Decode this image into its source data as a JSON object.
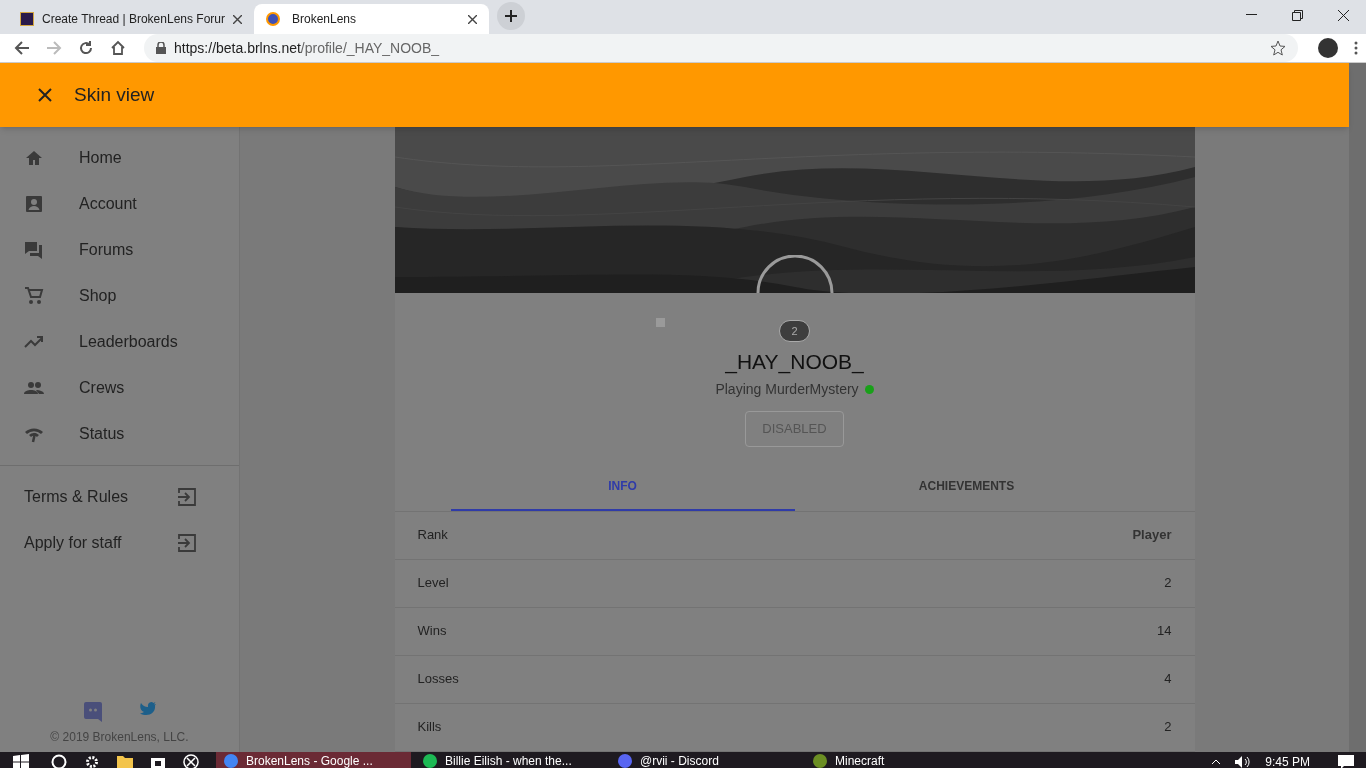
{
  "browser": {
    "tabs": [
      {
        "title": "Create Thread | BrokenLens Forur",
        "selected": false
      },
      {
        "title": "BrokenLens",
        "selected": true
      }
    ],
    "url_host": "https://beta.brlns.net",
    "url_path": "/profile/_HAY_NOOB_"
  },
  "header": {
    "title": "Skin view"
  },
  "sidebar": {
    "items": [
      "Home",
      "Account",
      "Forums",
      "Shop",
      "Leaderboards",
      "Crews",
      "Status"
    ],
    "links": [
      "Terms & Rules",
      "Apply for staff"
    ],
    "copyright": "© 2019 BrokenLens, LLC."
  },
  "profile": {
    "level": "2",
    "name": "_HAY_NOOB_",
    "status": "Playing MurderMystery",
    "online": true,
    "button": "DISABLED",
    "tabs": [
      {
        "label": "INFO",
        "selected": true
      },
      {
        "label": "ACHIEVEMENTS",
        "selected": false
      }
    ],
    "rows": [
      {
        "label": "Rank",
        "value": "Player"
      },
      {
        "label": "Level",
        "value": "2"
      },
      {
        "label": "Wins",
        "value": "14"
      },
      {
        "label": "Losses",
        "value": "4"
      },
      {
        "label": "Kills",
        "value": "2"
      }
    ]
  },
  "taskbar": {
    "apps": [
      {
        "label": "BrokenLens - Google ...",
        "selected": true
      },
      {
        "label": "Billie Eilish - when the...",
        "selected": false
      },
      {
        "label": "@rvii - Discord",
        "selected": false
      },
      {
        "label": "Minecraft",
        "selected": false
      }
    ],
    "time": "9:45 PM"
  }
}
